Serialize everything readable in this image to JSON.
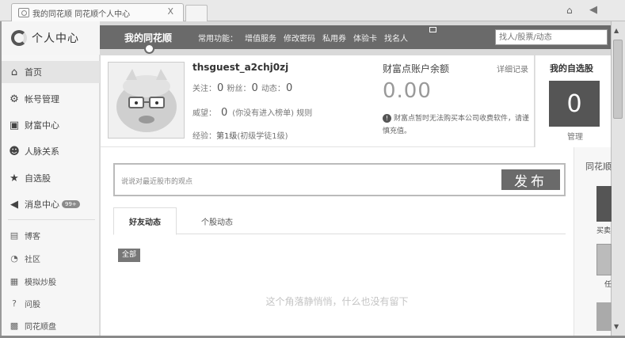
{
  "browser": {
    "tab_title": "我的同花顺 同花顺个人中心",
    "tab_close": "X"
  },
  "header": {
    "logo_text": "个人中心",
    "nav_active": "我的同花顺",
    "nav_links": [
      "常用功能：",
      "增值服务",
      "修改密码",
      "私用券",
      "体验卡",
      "找名人"
    ],
    "search_placeholder": "找人/股票/动态"
  },
  "sidebar": {
    "items": [
      {
        "label": "首页",
        "icon": "home-icon"
      },
      {
        "label": "帐号管理",
        "icon": "gear-icon"
      },
      {
        "label": "财富中心",
        "icon": "wallet-icon"
      },
      {
        "label": "人脉关系",
        "icon": "people-icon"
      },
      {
        "label": "自选股",
        "icon": "star-icon"
      },
      {
        "label": "消息中心",
        "icon": "speaker-icon",
        "badge": "99+"
      }
    ],
    "small_items": [
      {
        "label": "博客",
        "icon": "blog-icon"
      },
      {
        "label": "社区",
        "icon": "community-icon"
      },
      {
        "label": "模拟炒股",
        "icon": "chart-icon"
      },
      {
        "label": "问股",
        "icon": "question-icon"
      },
      {
        "label": "同花顺盘",
        "icon": "disk-icon"
      }
    ]
  },
  "profile": {
    "username": "thsguest_a2chj0zj",
    "follow_label": "关注：",
    "follow_count": "0",
    "fans_label": "粉丝：",
    "fans_count": "0",
    "posts_label": "动态：",
    "posts_count": "0",
    "prestige_label": "威望：",
    "prestige_value": "0",
    "prestige_note": "(你没有进入榜单) 规则",
    "exp_label": "经验：",
    "exp_level": "第1级",
    "exp_title": "(初级学徒1级)"
  },
  "wealth": {
    "title": "财富点账户余额",
    "detail_link": "详细记录",
    "balance": "0.00",
    "note": "财富点暂时无法购买本公司收费软件，请谨慎充值。"
  },
  "watchlist": {
    "title": "我的自选股",
    "count": "0",
    "manage": "管理"
  },
  "feed": {
    "post_placeholder": "说说对最近股市的观点",
    "publish_label": "发布",
    "tabs": [
      "好友动态",
      "个股动态"
    ],
    "filter_all": "全部",
    "empty_message": "这个角落静悄悄，什么也没有留下"
  },
  "right_panel": {
    "title": "同花顺",
    "thumb1_label": "买卖",
    "thumb2_label": "任"
  },
  "colors": {
    "navbar": "#6a6a6a",
    "button": "#6a6a6a",
    "sidebar_bg": "#f6f6f6"
  }
}
